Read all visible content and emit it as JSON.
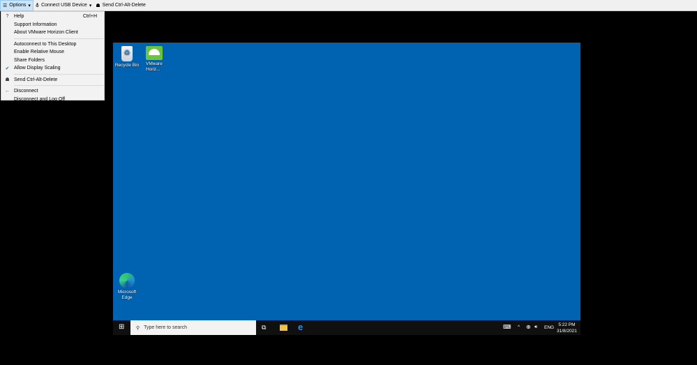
{
  "toolbar": {
    "options": "Options",
    "usb": "Connect USB Device",
    "cad": "Send Ctrl-Alt-Delete"
  },
  "menu": {
    "help": "Help",
    "help_shortcut": "Ctrl+H",
    "support": "Support Information",
    "about": "About VMware Horizon Client",
    "autoconnect": "Autoconnect to This Desktop",
    "relative_mouse": "Enable Relative Mouse",
    "share": "Share Folders",
    "scaling": "Allow Display Scaling",
    "scaling_checked": true,
    "cad": "Send Ctrl-Alt-Delete",
    "disconnect": "Disconnect",
    "logoff": "Disconnect and Log Off"
  },
  "desktop": {
    "recycle": "Recycle Bin",
    "vmware": "VMware Horiz...",
    "edge": "Microsoft Edge"
  },
  "taskbar": {
    "search_placeholder": "Type here to search",
    "lang": "ENG",
    "time": "5:22 PM",
    "date": "31/8/2021"
  }
}
